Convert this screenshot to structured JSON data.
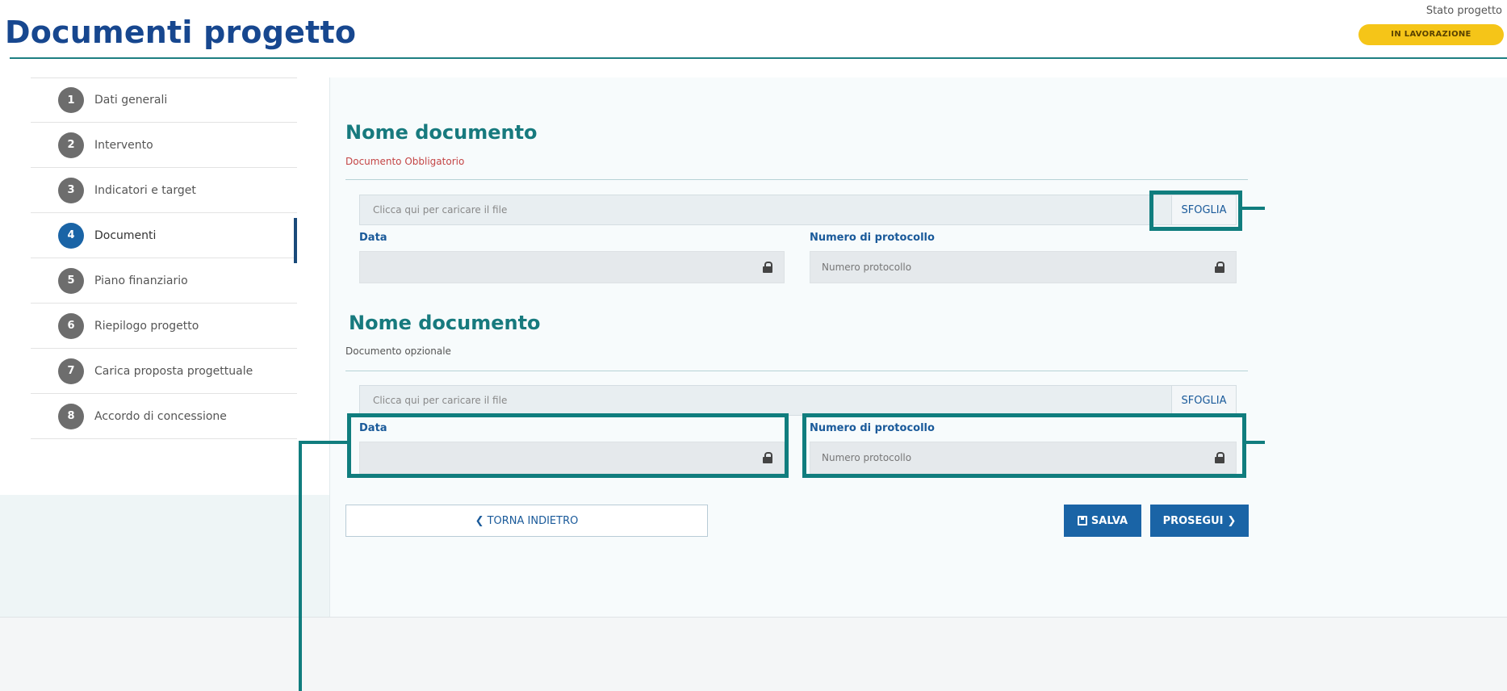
{
  "header": {
    "title": "Documenti progetto",
    "status_label": "Stato progetto",
    "status_badge": "IN LAVORAZIONE"
  },
  "stepper": [
    {
      "num": "1",
      "label": "Dati generali"
    },
    {
      "num": "2",
      "label": "Intervento"
    },
    {
      "num": "3",
      "label": "Indicatori e target"
    },
    {
      "num": "4",
      "label": "Documenti",
      "active": true
    },
    {
      "num": "5",
      "label": "Piano finanziario"
    },
    {
      "num": "6",
      "label": "Riepilogo progetto"
    },
    {
      "num": "7",
      "label": "Carica proposta progettuale"
    },
    {
      "num": "8",
      "label": "Accordo di concessione"
    }
  ],
  "documents": [
    {
      "title": "Nome documento",
      "subtitle": "Documento Obbligatorio",
      "file_placeholder": "Clicca qui per caricare il file",
      "browse_label": "SFOGLIA",
      "date_label": "Data",
      "protocol_label": "Numero di protocollo",
      "protocol_placeholder": "Numero protocollo"
    },
    {
      "title": "Nome documento",
      "subtitle": "Documento opzionale",
      "file_placeholder": "Clicca qui per caricare il file",
      "browse_label": "SFOGLIA",
      "date_label": "Data",
      "protocol_label": "Numero di protocollo",
      "protocol_placeholder": "Numero protocollo"
    }
  ],
  "actions": {
    "back_label": "TORNA INDIETRO",
    "back_icon": "chevron-left-icon",
    "save_label": "SALVA",
    "save_icon": "save-icon",
    "next_label": "PROSEGUI",
    "next_icon": "chevron-right-icon"
  },
  "colors": {
    "title": "#17478f",
    "accent_teal": "#107d7e",
    "badge": "#f5c518",
    "primary_button": "#1a64a6",
    "required_text": "#c44545"
  }
}
